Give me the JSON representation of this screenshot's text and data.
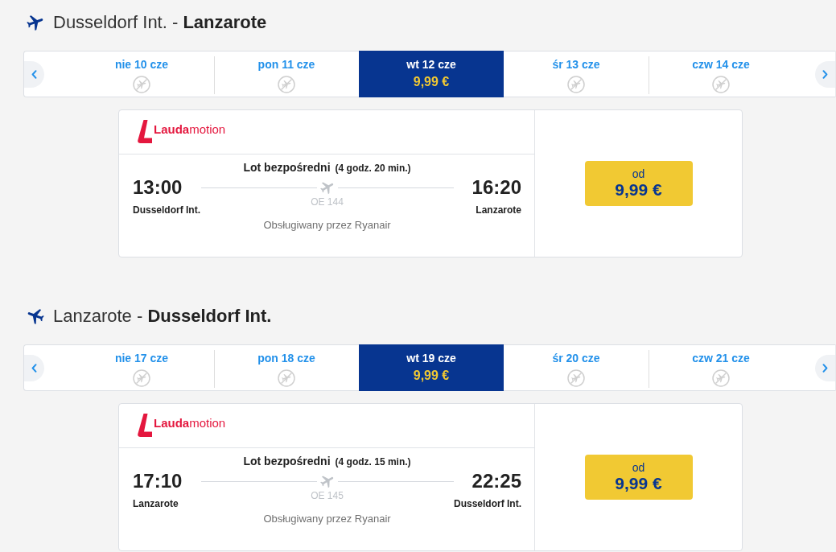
{
  "sections": [
    {
      "kind": "outbound",
      "title": "Dusseldorf Int. - **Lanzarote**",
      "dates": [
        {
          "label": "nie 10 cze",
          "selected": false
        },
        {
          "label": "pon 11 cze",
          "selected": false
        },
        {
          "label": "wt 12 cze",
          "selected": true,
          "price": "9,99 €"
        },
        {
          "label": "śr 13 cze",
          "selected": false
        },
        {
          "label": "czw 14 cze",
          "selected": false
        }
      ],
      "flights": [
        {
          "airline": "**Lauda**motion",
          "stop_type": "Lot bezpośredni",
          "duration": "(4 godz. 20 min.)",
          "departure": {
            "time": "13:00",
            "airport": "Dusseldorf Int."
          },
          "arrival": {
            "time": "16:20",
            "airport": "Lanzarote"
          },
          "flight_number": "OE 144",
          "operated_by": "Obsługiwany przez Ryanair",
          "fare": {
            "prefix": "od",
            "price": "9,99 €"
          }
        }
      ]
    },
    {
      "kind": "return",
      "title": "Lanzarote - **Dusseldorf Int.**",
      "dates": [
        {
          "label": "nie 17 cze",
          "selected": false
        },
        {
          "label": "pon 18 cze",
          "selected": false
        },
        {
          "label": "wt 19 cze",
          "selected": true,
          "price": "9,99 €"
        },
        {
          "label": "śr 20 cze",
          "selected": false
        },
        {
          "label": "czw 21 cze",
          "selected": false
        }
      ],
      "flights": [
        {
          "airline": "**Lauda**motion",
          "stop_type": "Lot bezpośredni",
          "duration": "(4 godz. 15 min.)",
          "departure": {
            "time": "17:10",
            "airport": "Lanzarote"
          },
          "arrival": {
            "time": "22:25",
            "airport": "Dusseldorf Int."
          },
          "flight_number": "OE 145",
          "operated_by": "Obsługiwany przez Ryanair",
          "fare": {
            "prefix": "od",
            "price": "9,99 €"
          }
        }
      ]
    }
  ]
}
